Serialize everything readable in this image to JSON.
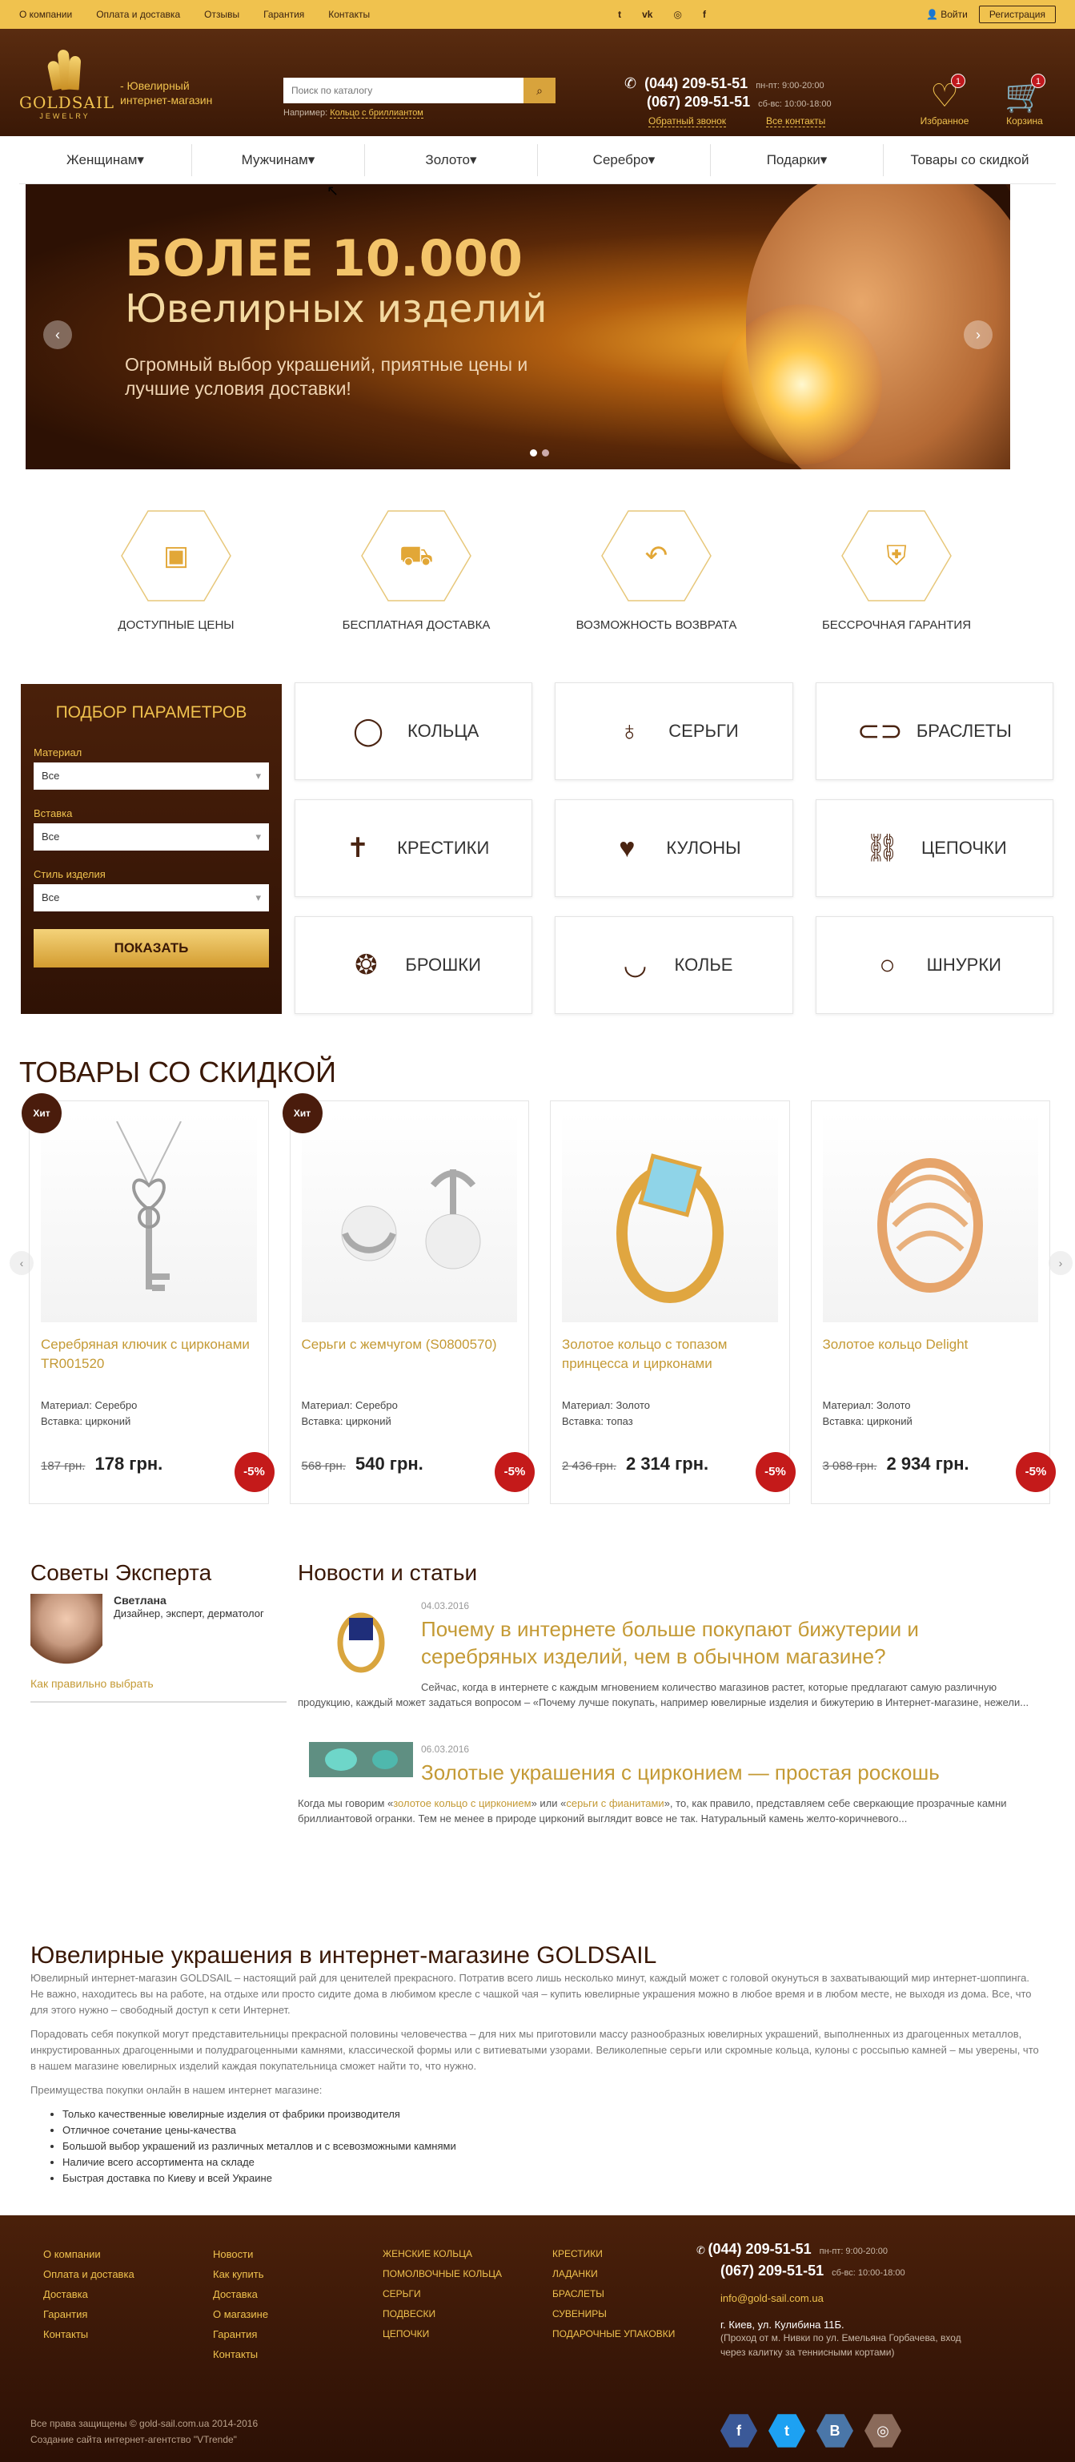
{
  "topbar": {
    "links": [
      "О компании",
      "Оплата и доставка",
      "Отзывы",
      "Гарантия",
      "Контакты"
    ],
    "social": [
      "twitter-icon",
      "vk-icon",
      "instagram-icon",
      "facebook-icon"
    ],
    "social_glyphs": [
      "t",
      "vk",
      "◎",
      "f"
    ],
    "login": "Войти",
    "register": "Регистрация"
  },
  "header": {
    "logo_name": "GOLDSAIL",
    "logo_sub": "JEWELRY",
    "tagline_1": "- Ювелирный",
    "tagline_2": "интернет-магазин",
    "search_placeholder": "Поиск по каталогу",
    "search_hint_prefix": "Например:",
    "search_hint_link": "Кольцо с бриллиантом",
    "phone1": "(044) 209-51-51",
    "hours1": "пн-пт: 9:00-20:00",
    "phone2": "(067) 209-51-51",
    "hours2": "сб-вс: 10:00-18:00",
    "callback": "Обратный звонок",
    "all_contacts": "Все контакты",
    "favorites": "Избранное",
    "favorites_count": "1",
    "cart": "Корзина",
    "cart_count": "1"
  },
  "nav": [
    "Женщинам",
    "Мужчинам",
    "Золото",
    "Серебро",
    "Подарки",
    "Товары со скидкой"
  ],
  "banner": {
    "h1": "БОЛЕЕ 10.000",
    "h2": "Ювелирных изделий",
    "p": "Огромный выбор украшений, приятные цены и лучшие условия доставки!"
  },
  "features": [
    {
      "icon": "wallet-icon",
      "label": "ДОСТУПНЫЕ ЦЕНЫ"
    },
    {
      "icon": "truck-icon",
      "label": "БЕСПЛАТНАЯ ДОСТАВКА"
    },
    {
      "icon": "return-icon",
      "label": "ВОЗМОЖНОСТЬ ВОЗВРАТА"
    },
    {
      "icon": "shield-icon",
      "label": "БЕССРОЧНАЯ ГАРАНТИЯ"
    }
  ],
  "filter": {
    "title": "ПОДБОР ПАРАМЕТРОВ",
    "material_label": "Материал",
    "material_value": "Все",
    "insert_label": "Вставка",
    "insert_value": "Все",
    "style_label": "Стиль изделия",
    "style_value": "Все",
    "show": "ПОКАЗАТЬ"
  },
  "categories": [
    {
      "icon": "ring-icon",
      "label": "КОЛЬЦА"
    },
    {
      "icon": "earrings-icon",
      "label": "СЕРЬГИ"
    },
    {
      "icon": "bracelet-icon",
      "label": "БРАСЛЕТЫ"
    },
    {
      "icon": "cross-icon",
      "label": "КРЕСТИКИ"
    },
    {
      "icon": "pendant-icon",
      "label": "КУЛОНЫ"
    },
    {
      "icon": "chain-icon",
      "label": "ЦЕПОЧКИ"
    },
    {
      "icon": "brooch-icon",
      "label": "БРОШКИ"
    },
    {
      "icon": "necklace-icon",
      "label": "КОЛЬЕ"
    },
    {
      "icon": "cord-icon",
      "label": "ШНУРКИ"
    }
  ],
  "sale": {
    "title": "ТОВАРЫ СО СКИДКОЙ",
    "products": [
      {
        "badge": "Хит",
        "name": "Серебряная ключик с цирконами TR001520",
        "material": "Материал: Серебро",
        "insert": "Вставка: цирконий",
        "old": "187 грн.",
        "new": "178 грн.",
        "disc": "-5%"
      },
      {
        "badge": "Хит",
        "name": "Серьги с жемчугом (S0800570)",
        "material": "Материал: Серебро",
        "insert": "Вставка: цирконий",
        "old": "568 грн.",
        "new": "540 грн.",
        "disc": "-5%"
      },
      {
        "badge": "",
        "name": "Золотое кольцо с топазом принцесса и цирконами",
        "material": "Материал: Золото",
        "insert": "Вставка: топаз",
        "old": "2 436 грн.",
        "new": "2 314 грн.",
        "disc": "-5%"
      },
      {
        "badge": "",
        "name": "Золотое кольцо Delight",
        "material": "Материал: Золото",
        "insert": "Вставка: цирконий",
        "old": "3 088 грн.",
        "new": "2 934 грн.",
        "disc": "-5%"
      }
    ]
  },
  "expert": {
    "title": "Советы Эксперта",
    "name": "Светлана",
    "role": "Дизайнер, эксперт, дерматолог",
    "link": "Как правильно выбрать"
  },
  "news": {
    "title": "Новости и статьи",
    "articles": [
      {
        "date": "04.03.2016",
        "title": "Почему в интернете больше покупают бижутерии и серебряных изделий, чем в обычном магазине?",
        "text": "Сейчас, когда в интернете с каждым мгновением количество магазинов растет, которые предлагают самую различную продукцию, каждый может задаться вопросом – «Почему лучше покупать, например ювелирные изделия и бижутерию в Интернет-магазине, нежели..."
      },
      {
        "date": "06.03.2016",
        "title": "Золотые украшения с цирконием — простая роскошь",
        "text_1": "Когда мы говорим «",
        "link_1": "золотое кольцо с цирконием",
        "text_2": "» или «",
        "link_2": "серьги с фианитами",
        "text_3": "», то, как правило, представляем себе сверкающие прозрачные камни бриллиантовой огранки. Тем не менее в природе цирконий выглядит вовсе не так. Натуральный камень желто-коричневого..."
      }
    ]
  },
  "seo": {
    "title": "Ювелирные украшения в интернет-магазине GOLDSAIL",
    "p1": "Ювелирный интернет-магазин GOLDSAIL – настоящий рай для ценителей прекрасного. Потратив всего лишь несколько минут, каждый может с головой окунуться в захватывающий мир интернет-шоппинга. Не важно, находитесь вы на работе, на отдыхе или просто сидите дома в любимом кресле с чашкой чая – купить ювелирные украшения можно в любое время и в любом месте, не выходя из дома. Все, что для этого нужно – свободный доступ к сети Интернет.",
    "p2": "Порадовать себя покупкой могут представительницы прекрасной половины человечества – для них мы приготовили массу разнообразных ювелирных украшений, выполненных из драгоценных металлов, инкрустированных драгоценными и полудрагоценными камнями, классической формы или с витиеватыми узорами. Великолепные серьги или скромные кольца, кулоны с россыпью камней – мы уверены, что в нашем магазине ювелирных изделий каждая покупательница сможет найти то, что нужно.",
    "p3": "Преимущества покупки онлайн в нашем интернет магазине:",
    "list": [
      "Только качественные ювелирные изделия от фабрики производителя",
      "Отличное сочетание цены-качества",
      "Большой выбор украшений из различных металлов и с всевозможными камнями",
      "Наличие всего ассортимента на складе",
      "Быстрая доставка по Киеву и всей Украине"
    ]
  },
  "footer": {
    "col1": [
      "О компании",
      "Оплата и доставка",
      "Доставка",
      "Гарантия",
      "Контакты"
    ],
    "col2": [
      "Новости",
      "Как купить",
      "Доставка",
      "О магазине",
      "Гарантия",
      "Контакты"
    ],
    "col3": [
      "Женские кольца",
      "Помолвочные кольца",
      "Серьги",
      "Подвески",
      "Цепочки"
    ],
    "col4": [
      "Крестики",
      "Ладанки",
      "Браслеты",
      "Сувениры",
      "Подарочные упаковки"
    ],
    "phone1": "(044) 209-51-51",
    "hours1": "пн-пт: 9:00-20:00",
    "phone2": "(067) 209-51-51",
    "hours2": "сб-вс: 10:00-18:00",
    "email": "info@gold-sail.com.ua",
    "address": "г. Киев, ул. Кулибина 11Б.",
    "note": "(Проход от м. Нивки по ул. Емельяна Горбачева, вход через калитку за теннисными кортами)",
    "social": [
      {
        "icon": "facebook-icon",
        "glyph": "f",
        "color": "#3b5998"
      },
      {
        "icon": "twitter-icon",
        "glyph": "t",
        "color": "#1da1f2"
      },
      {
        "icon": "vk-icon",
        "glyph": "В",
        "color": "#4a76a8"
      },
      {
        "icon": "instagram-icon",
        "glyph": "◎",
        "color": "#8a6a5a"
      }
    ],
    "copy1": "Все права защищены © gold-sail.com.ua 2014-2016",
    "copy2": "Создание сайта интернет-агентство \"VTrende\""
  }
}
